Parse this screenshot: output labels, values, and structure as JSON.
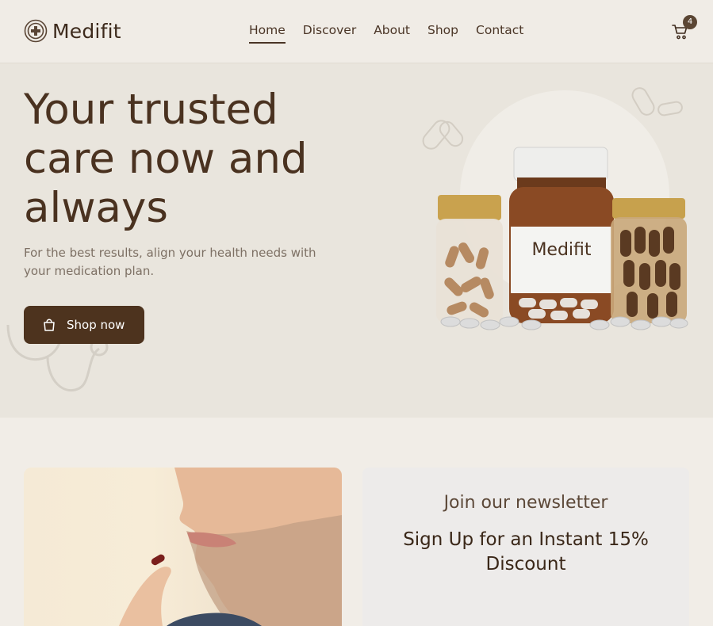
{
  "header": {
    "brand": "Medifit",
    "nav": [
      {
        "label": "Home",
        "active": true
      },
      {
        "label": "Discover",
        "active": false
      },
      {
        "label": "About",
        "active": false
      },
      {
        "label": "Shop",
        "active": false
      },
      {
        "label": "Contact",
        "active": false
      }
    ],
    "cart_count": "4",
    "icons": {
      "logo": "medical-cross-icon",
      "cart": "shopping-cart-icon"
    }
  },
  "hero": {
    "title": "Your trusted care now and always",
    "subtitle": "For the best results, align your health needs with your medication plan.",
    "cta_label": "Shop now",
    "cta_icon": "shopping-bag-icon",
    "bottle_label": "Medifit"
  },
  "newsletter": {
    "title": "Join our newsletter",
    "subtitle": "Sign Up for an Instant 15% Discount"
  },
  "colors": {
    "brand_brown": "#4d331e",
    "hero_bg": "#e9e5dd",
    "page_bg": "#f1ede7"
  }
}
